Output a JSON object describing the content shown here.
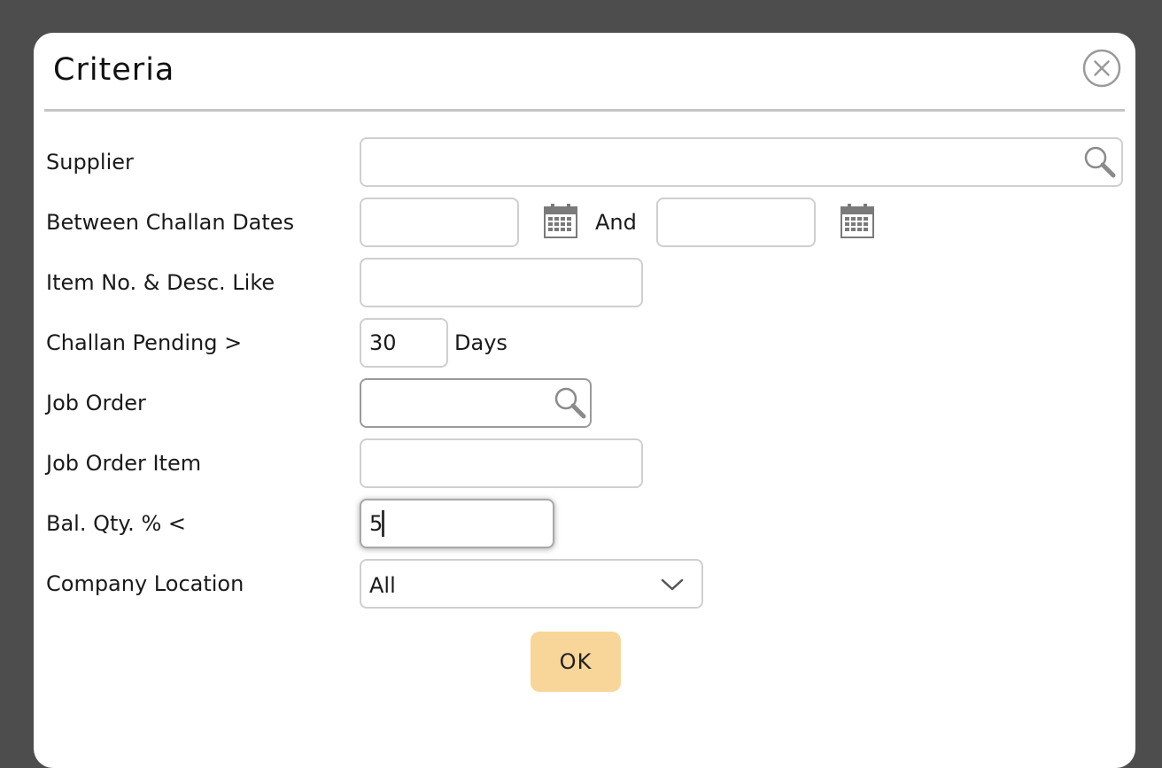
{
  "dialog": {
    "title": "Criteria",
    "close_icon": "close-circle-icon"
  },
  "form": {
    "supplier": {
      "label": "Supplier",
      "value": "",
      "icon": "search-icon"
    },
    "challan_dates": {
      "label": "Between Challan Dates",
      "from_value": "",
      "and_label": "And",
      "to_value": "",
      "icon": "calendar-icon"
    },
    "item_desc": {
      "label": "Item No. & Desc. Like",
      "value": ""
    },
    "challan_pending": {
      "label": "Challan Pending >",
      "value": "30",
      "unit": "Days"
    },
    "job_order": {
      "label": "Job Order",
      "value": "",
      "icon": "search-icon"
    },
    "job_order_item": {
      "label": "Job Order Item",
      "value": ""
    },
    "bal_qty": {
      "label": "Bal. Qty. % <",
      "value": "5"
    },
    "company_location": {
      "label": "Company Location",
      "selected": "All",
      "icon": "chevron-down-icon"
    }
  },
  "actions": {
    "ok_label": "OK"
  },
  "colors": {
    "backdrop": "#4d4d4d",
    "ok_button": "#f8d699",
    "divider": "#c4c4c4"
  }
}
